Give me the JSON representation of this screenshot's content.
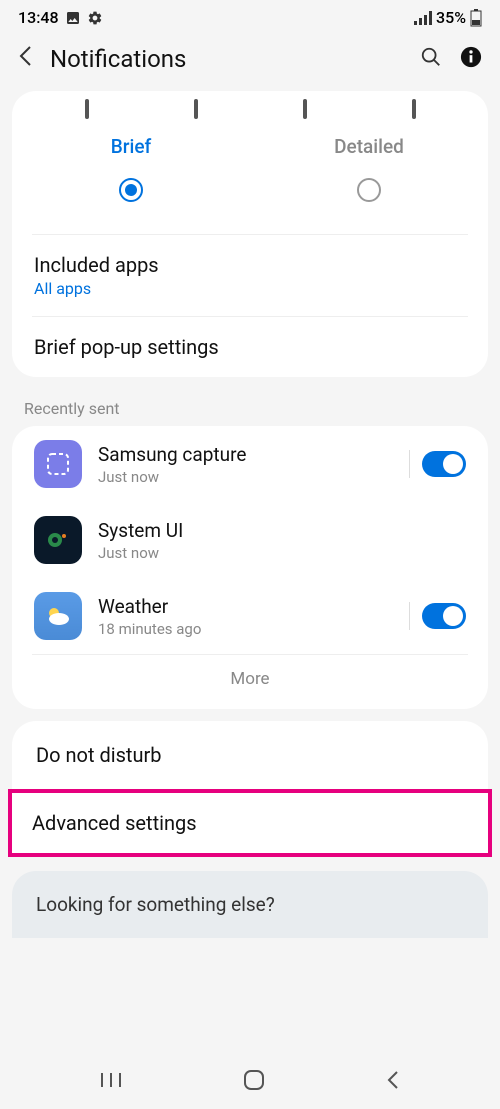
{
  "status": {
    "time": "13:48",
    "battery": "35%"
  },
  "header": {
    "title": "Notifications"
  },
  "style": {
    "brief_label": "Brief",
    "detailed_label": "Detailed"
  },
  "included": {
    "title": "Included apps",
    "subtitle": "All apps"
  },
  "popup": {
    "title": "Brief pop-up settings"
  },
  "recent": {
    "header": "Recently sent",
    "apps": [
      {
        "name": "Samsung capture",
        "time": "Just now",
        "toggle": true
      },
      {
        "name": "System UI",
        "time": "Just now",
        "toggle": false
      },
      {
        "name": "Weather",
        "time": "18 minutes ago",
        "toggle": true
      }
    ],
    "more": "More"
  },
  "menu": {
    "dnd": "Do not disturb",
    "advanced": "Advanced settings"
  },
  "footer": {
    "text": "Looking for something else?"
  }
}
